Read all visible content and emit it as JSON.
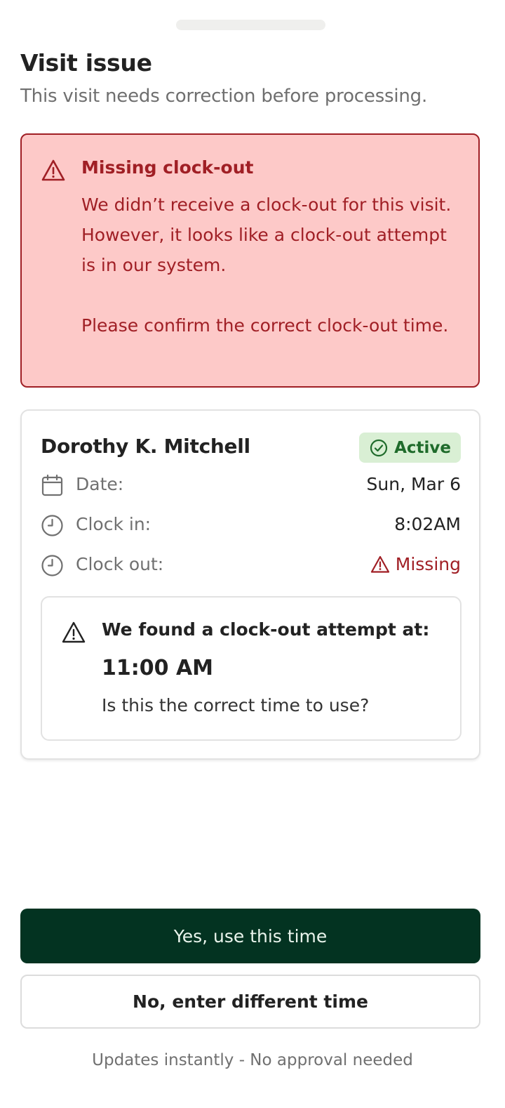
{
  "sheet": {
    "title": "Visit issue",
    "subtitle": "This visit needs correction before processing."
  },
  "alert": {
    "icon": "warning-triangle-icon",
    "title": "Missing clock-out",
    "body": "We didn’t receive a clock-out for this visit. However, it looks like a clock-out attempt is in our system.\n\nPlease confirm the correct clock-out time.",
    "color": "#a01f25",
    "background": "#fdc9c8"
  },
  "visit": {
    "name": "Dorothy K. Mitchell",
    "status": "Active",
    "status_icon": "check-circle-icon",
    "rows": [
      {
        "icon": "calendar-icon",
        "label": "Date:",
        "value": "Sun, Mar 6"
      },
      {
        "icon": "clock-icon",
        "label": "Clock in:",
        "value": "8:02AM"
      },
      {
        "icon": "clock-icon",
        "label": "Clock out:",
        "value": "Missing"
      }
    ],
    "attempt": {
      "icon": "warning-triangle-icon",
      "title": "We found a clock-out attempt at:",
      "time": "11:00 AM",
      "question": "Is this the correct time to use?"
    }
  },
  "actions": {
    "confirm_label": "Yes, use this time",
    "different_label": "No, enter different time",
    "footnote": "Updates instantly - No approval needed"
  },
  "colors": {
    "primary": "#033321",
    "success_bg": "#d9efd4",
    "success_text": "#1f6b2b",
    "error": "#a01f25"
  }
}
